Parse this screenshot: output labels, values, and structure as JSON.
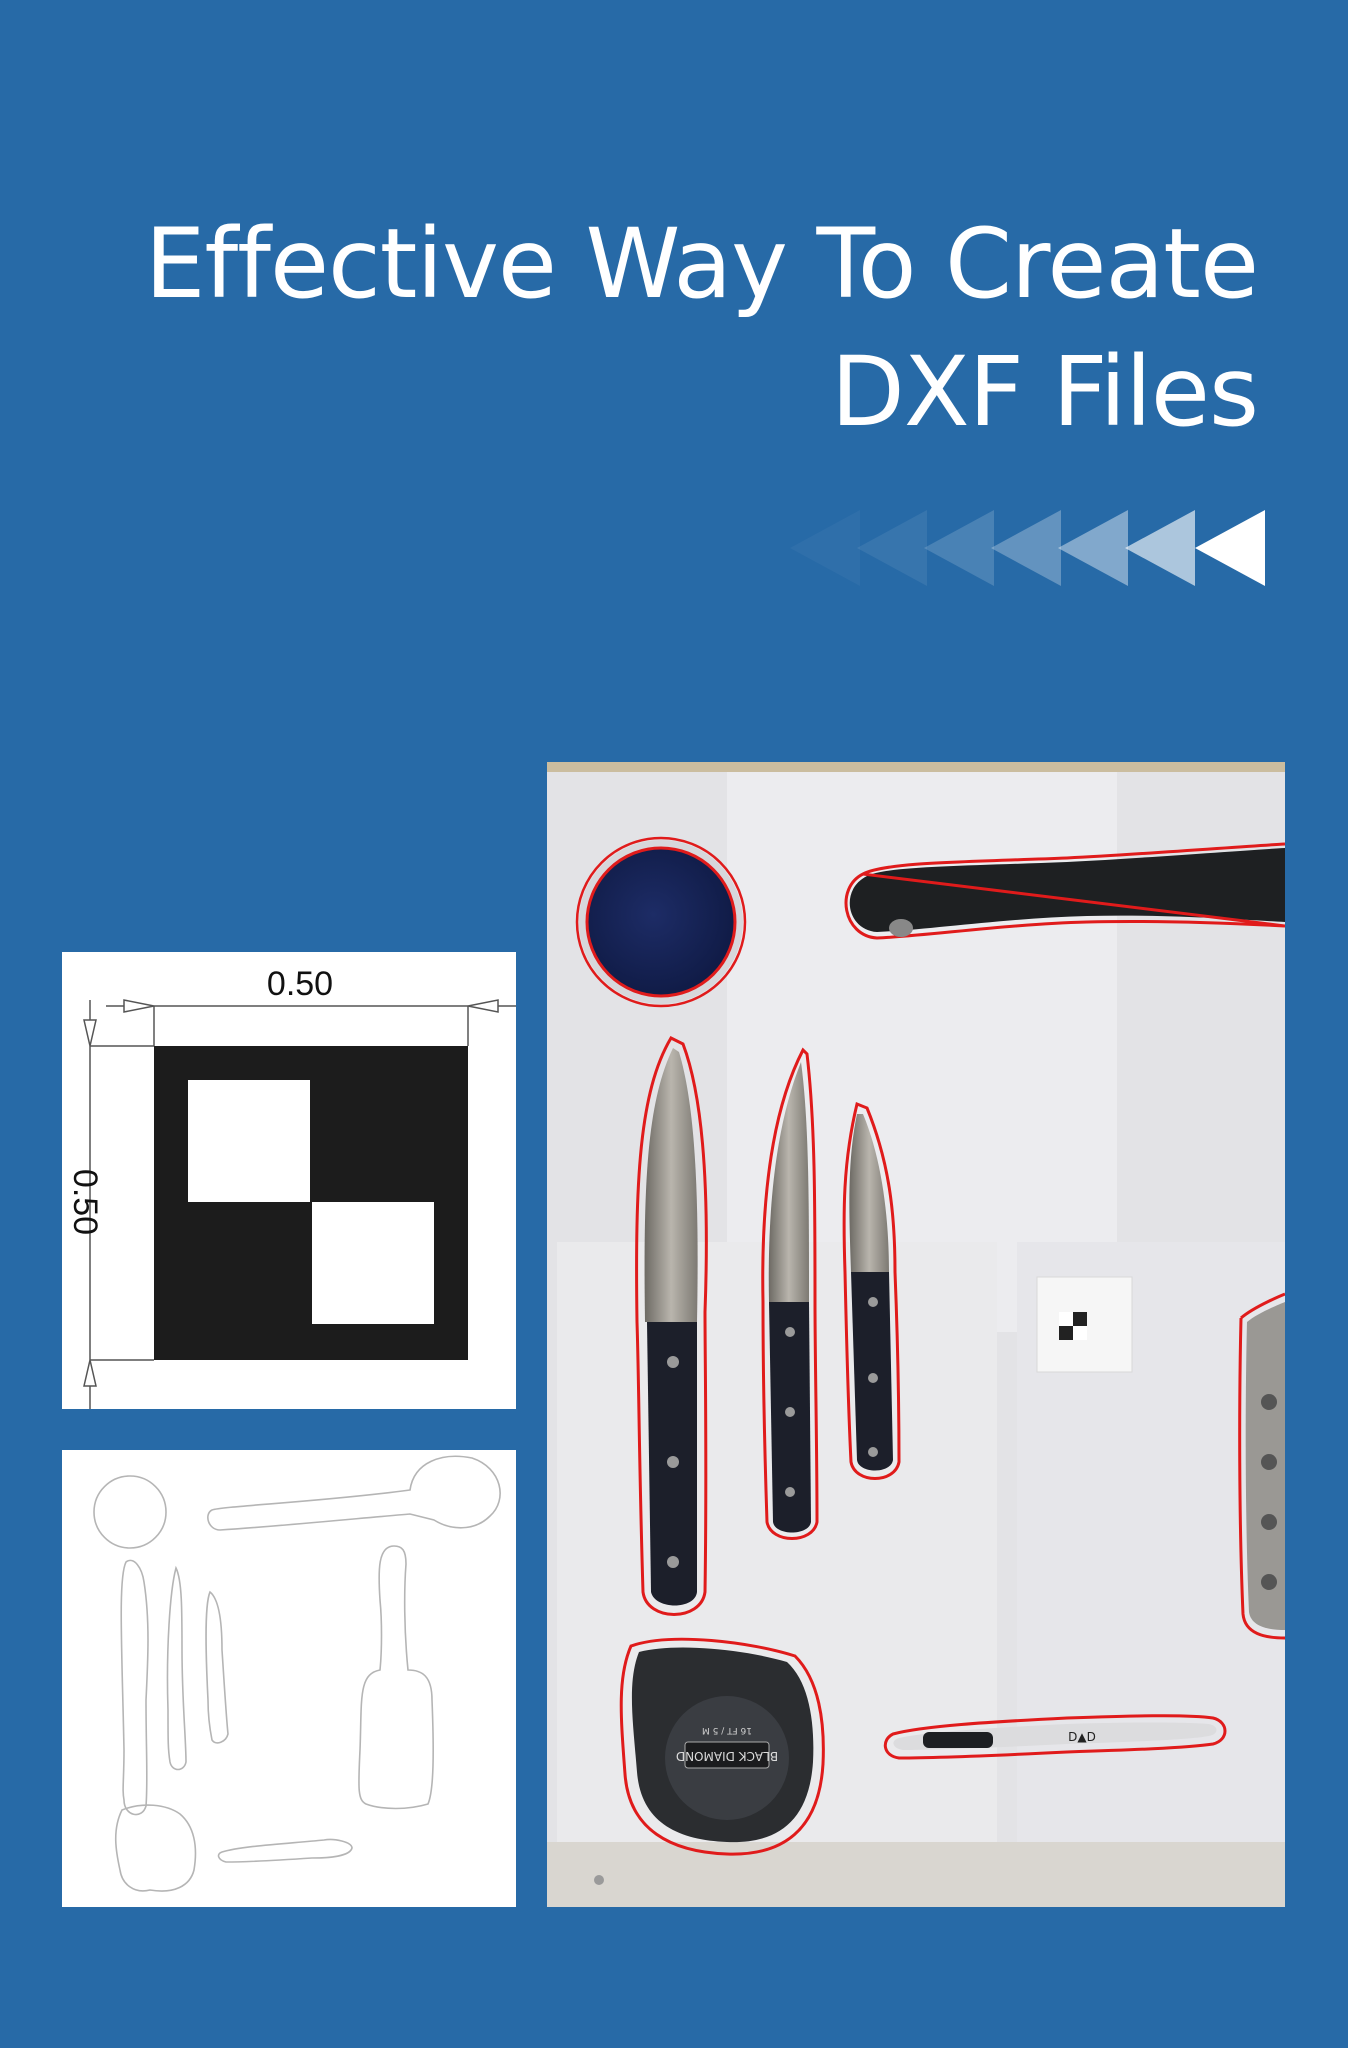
{
  "title": {
    "line1": "Effective Way To Create",
    "line2": "DXF Files"
  },
  "colors": {
    "background": "#276aa7",
    "text": "#ffffff",
    "outline_red": "#e01b1b"
  },
  "marker_drawing": {
    "width_label": "0.50",
    "height_label": "0.50"
  },
  "photo": {
    "tape_text_top": "16 FT / 5 M",
    "tape_brand": "BLACK DIAMOND",
    "pen_logo": "D▲D"
  }
}
